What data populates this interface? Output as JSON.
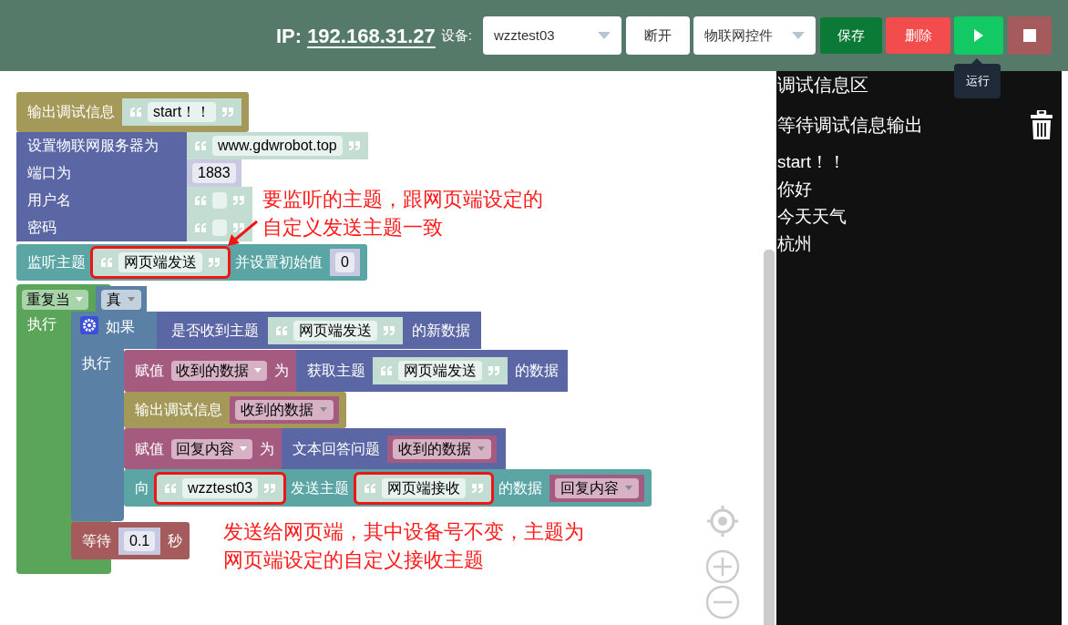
{
  "header": {
    "ip_label": "IP:",
    "ip": "192.168.31.27",
    "device_label": "设备:",
    "device_select": "wzztest03",
    "disconnect_button": "断开",
    "control_select": "物联网控件",
    "save_button": "保存",
    "delete_button": "删除",
    "tooltip": "运行"
  },
  "workspace": {
    "blocks": [
      {
        "kind": "print",
        "parts": [
          {
            "kind": "label",
            "text": "输出调试信息"
          },
          {
            "kind": "string",
            "text": "start！！",
            "highlighted": false
          }
        ]
      },
      {
        "kind": "iot",
        "rows": [
          [
            {
              "kind": "label",
              "text": "设置物联网服务器为"
            },
            {
              "kind": "string",
              "text": "www.gdwrobot.top",
              "highlighted": false
            }
          ],
          [
            {
              "kind": "label",
              "text": "端口为"
            },
            {
              "kind": "number",
              "text": "1883"
            }
          ],
          [
            {
              "kind": "label",
              "text": "用户名"
            },
            {
              "kind": "string",
              "highlighted": false
            }
          ],
          [
            {
              "kind": "label",
              "text": "密码"
            },
            {
              "kind": "string",
              "highlighted": false
            }
          ]
        ]
      },
      {
        "kind": "listen",
        "parts": [
          {
            "kind": "label",
            "text": "监听主题"
          },
          {
            "kind": "string",
            "text": "网页端发送",
            "highlighted": true
          },
          {
            "kind": "label",
            "text": "并设置初始值"
          },
          {
            "kind": "number",
            "text": "0"
          }
        ]
      },
      {
        "kind": "repeat",
        "parts": [
          {
            "kind": "dropdown",
            "text": "重复当"
          },
          {
            "kind": "bool",
            "text": "真"
          }
        ],
        "do_label": "执行"
      },
      {
        "kind": "if",
        "parts": [
          {
            "kind": "gear"
          },
          {
            "kind": "label",
            "text": "如果"
          }
        ],
        "condition": {
          "kind": "query",
          "parts": [
            {
              "kind": "label",
              "text": "是否收到主题"
            },
            {
              "kind": "string",
              "text": "网页端发送",
              "highlighted": false
            },
            {
              "kind": "label",
              "text": "的新数据"
            }
          ]
        },
        "do_label": "执行"
      },
      {
        "kind": "assign",
        "parts": [
          {
            "kind": "label",
            "text": "赋值"
          },
          {
            "kind": "dropdown",
            "text": "收到的数据"
          },
          {
            "kind": "label",
            "text": "为"
          },
          {
            "kind": "query",
            "parts": [
              {
                "kind": "label",
                "text": "获取主题"
              },
              {
                "kind": "string",
                "text": "网页端发送",
                "highlighted": false
              },
              {
                "kind": "label",
                "text": "的数据"
              }
            ]
          }
        ]
      },
      {
        "kind": "print",
        "parts": [
          {
            "kind": "label",
            "text": "输出调试信息"
          },
          {
            "kind": "variable",
            "text": "收到的数据"
          }
        ]
      },
      {
        "kind": "assign",
        "parts": [
          {
            "kind": "label",
            "text": "赋值"
          },
          {
            "kind": "dropdown",
            "text": "回复内容"
          },
          {
            "kind": "label",
            "text": "为"
          },
          {
            "kind": "query",
            "parts": [
              {
                "kind": "label",
                "text": "文本回答问题"
              },
              {
                "kind": "variable",
                "text": "收到的数据"
              }
            ]
          }
        ]
      },
      {
        "kind": "send",
        "parts": [
          {
            "kind": "label",
            "text": "向"
          },
          {
            "kind": "string",
            "text": "wzztest03",
            "highlighted": true
          },
          {
            "kind": "label",
            "text": "发送主题"
          },
          {
            "kind": "string",
            "text": "网页端接收",
            "highlighted": true
          },
          {
            "kind": "label",
            "text": "的数据"
          },
          {
            "kind": "variable",
            "text": "回复内容"
          }
        ]
      },
      {
        "kind": "wait",
        "parts": [
          {
            "kind": "label",
            "text": "等待"
          },
          {
            "kind": "number",
            "text": "0.1"
          },
          {
            "kind": "label",
            "text": "秒"
          }
        ]
      }
    ],
    "annotations": [
      {
        "lines": [
          "要监听的主题，跟网页端设定的",
          "自定义发送主题一致"
        ]
      },
      {
        "lines": [
          "发送给网页端，其中设备号不变，主题为",
          "网页端设定的自定义接收主题"
        ]
      }
    ]
  },
  "debug_panel": {
    "title": "调试信息区",
    "status": "等待调试信息输出",
    "lines": [
      "start！！",
      "你好",
      "今天天气",
      "杭州"
    ]
  }
}
